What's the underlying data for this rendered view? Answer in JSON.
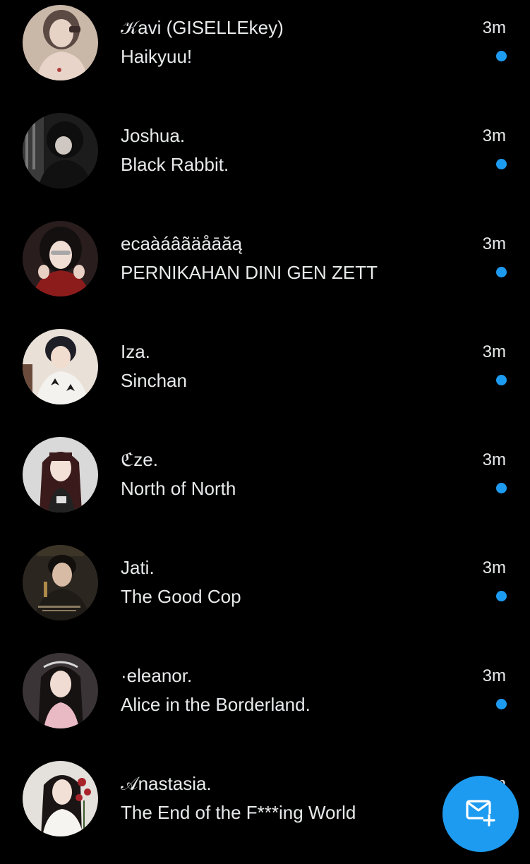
{
  "colors": {
    "background": "#000000",
    "text": "#e7e9ea",
    "unread_dot": "#1d9bf0",
    "fab": "#1d9bf0"
  },
  "conversations": [
    {
      "name": "𝒦avi (GISELLEkey)",
      "preview": "Haikyuu!",
      "time": "3m",
      "unread": true,
      "avatar": "avatar-photo"
    },
    {
      "name": "Joshua.",
      "preview": "Black Rabbit.",
      "time": "3m",
      "unread": true,
      "avatar": "avatar-photo"
    },
    {
      "name": "ecaàáâãäåāăą",
      "preview": "PERNIKAHAN DINI GEN ZETT",
      "time": "3m",
      "unread": true,
      "avatar": "avatar-photo"
    },
    {
      "name": "Iza.",
      "preview": "Sinchan",
      "time": "3m",
      "unread": true,
      "avatar": "avatar-photo"
    },
    {
      "name": "ℭze.",
      "preview": "North of North",
      "time": "3m",
      "unread": true,
      "avatar": "avatar-photo"
    },
    {
      "name": "Jati.",
      "preview": "The Good Cop",
      "time": "3m",
      "unread": true,
      "avatar": "avatar-photo"
    },
    {
      "name": "·eleanor.",
      "preview": "Alice in the Borderland.",
      "time": "3m",
      "unread": true,
      "avatar": "avatar-photo"
    },
    {
      "name": "𝒜nastasia.",
      "preview": "The End of the F***ing World",
      "time": "3m",
      "unread": true,
      "avatar": "avatar-photo"
    }
  ],
  "fab": {
    "icon": "new-message-icon"
  }
}
